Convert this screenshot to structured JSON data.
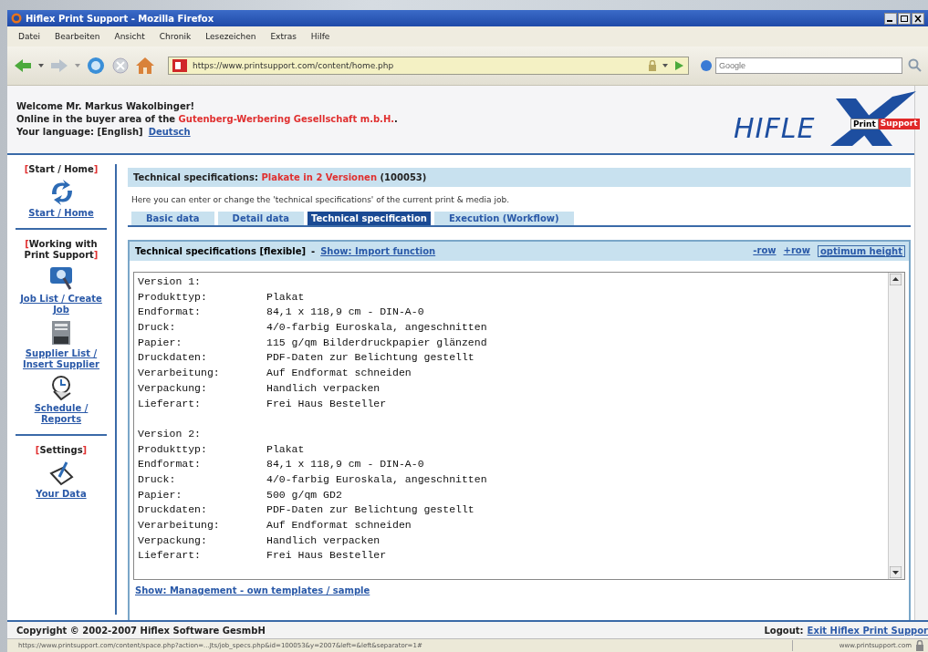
{
  "window": {
    "title": "Hiflex Print Support - Mozilla Firefox"
  },
  "menu": [
    "Datei",
    "Bearbeiten",
    "Ansicht",
    "Chronik",
    "Lesezeichen",
    "Extras",
    "Hilfe"
  ],
  "address_bar": {
    "value": "https://www.printsupport.com/content/home.php"
  },
  "search": {
    "placeholder": "Google"
  },
  "header": {
    "welcome": "Welcome Mr. Markus Wakolbinger!",
    "online_prefix": "Online in the buyer area of the",
    "company": "Gutenberg-Werbering Gesellschaft m.b.H.",
    "online_suffix": ".",
    "language_label": "Your language: [English]",
    "language_link": "Deutsch"
  },
  "logo": {
    "wordmark": "HIFLE",
    "badge_left": "Print",
    "badge_right": "Support"
  },
  "sidebar": [
    {
      "open": "[",
      "heading": "Start / Home",
      "close": "]",
      "items": [
        {
          "kind": "arrows",
          "label": "Start / Home"
        }
      ]
    },
    {
      "open": "[",
      "heading": "Working with Print Support",
      "close": "]",
      "items": [
        {
          "kind": "search",
          "label": "Job List / Create Job"
        },
        {
          "kind": "list",
          "label": "Supplier List / Insert Supplier"
        },
        {
          "kind": "clock",
          "label": "Schedule / Reports"
        }
      ]
    },
    {
      "open": "[",
      "heading": "Settings",
      "close": "]",
      "items": [
        {
          "kind": "pen",
          "label": "Your Data"
        }
      ]
    }
  ],
  "content": {
    "title_prefix": "Technical specifications:",
    "title_job": "Plakate in 2 Versionen",
    "title_id": "(100053)",
    "intro": "Here you can enter or change the 'technical specifications' of the current print & media job.",
    "tabs": [
      {
        "label": "Basic data",
        "selected": false
      },
      {
        "label": "Detail data",
        "selected": false
      },
      {
        "label": "Technical specification",
        "selected": true
      },
      {
        "label": "Execution (Workflow)",
        "selected": false
      }
    ],
    "panel": {
      "title": "Technical specifications [flexible]",
      "separator": "-",
      "link": "Show: Import function",
      "actions": [
        {
          "label": "-row",
          "boxed": false
        },
        {
          "label": "+row",
          "boxed": false
        },
        {
          "label": "optimum height",
          "boxed": true
        }
      ],
      "blocks": [
        {
          "lines": [
            {
              "label": "Version 1:"
            },
            {
              "label": "Produkttyp:",
              "value": "Plakat"
            },
            {
              "label": "Endformat:",
              "value": "84,1 x 118,9 cm - DIN-A-0"
            },
            {
              "label": "Druck:",
              "value": "4/0-farbig Euroskala, angeschnitten"
            },
            {
              "label": "Papier:",
              "value": "115 g/qm Bilderdruckpapier glänzend"
            },
            {
              "label": "Druckdaten:",
              "value": "PDF-Daten zur Belichtung gestellt"
            },
            {
              "label": "Verarbeitung:",
              "value": "Auf Endformat schneiden"
            },
            {
              "label": "Verpackung:",
              "value": "Handlich verpacken"
            },
            {
              "label": "Lieferart:",
              "value": "Frei Haus Besteller"
            }
          ]
        },
        {
          "lines": [
            {
              "label": "Version 2:"
            },
            {
              "label": "Produkttyp:",
              "value": "Plakat"
            },
            {
              "label": "Endformat:",
              "value": "84,1 x 118,9 cm - DIN-A-0"
            },
            {
              "label": "Druck:",
              "value": "4/0-farbig Euroskala, angeschnitten"
            },
            {
              "label": "Papier:",
              "value": "500 g/qm GD2"
            },
            {
              "label": "Druckdaten:",
              "value": "PDF-Daten zur Belichtung gestellt"
            },
            {
              "label": "Verarbeitung:",
              "value": "Auf Endformat schneiden"
            },
            {
              "label": "Verpackung:",
              "value": "Handlich verpacken"
            },
            {
              "label": "Lieferart:",
              "value": "Frei Haus Besteller"
            }
          ]
        }
      ],
      "bottom_link": "Show: Management - own templates / sample"
    }
  },
  "footer": {
    "copyright": "Copyright © 2002-2007 Hiflex Software GesmbH",
    "logout_label": "Logout:",
    "logout_link": "Exit Hiflex Print Suppor"
  },
  "status_bar": {
    "url": "https://www.printsupport.com/content/space.php?action=...Jts/job_specs.php&id=100053&y=2007&left=&left&separator=1#",
    "host": "www.printsupport.com"
  }
}
